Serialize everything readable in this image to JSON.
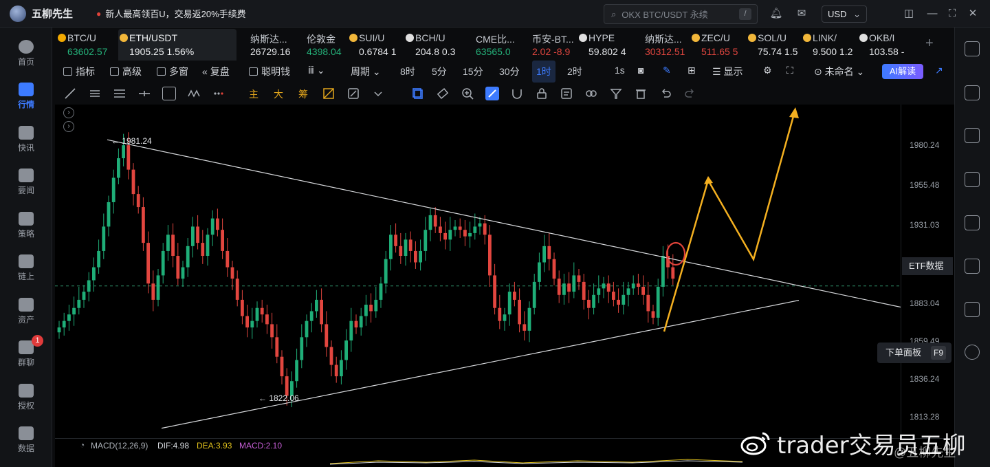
{
  "app": {
    "title": "五柳先生",
    "promo": "新人最高领百U，交易返20%手续费",
    "search_placeholder": "OKX BTC/USDT 永续",
    "search_shortcut": "/",
    "currency": "USD"
  },
  "left_nav": [
    {
      "label": "首页",
      "icon": "home-icon"
    },
    {
      "label": "行情",
      "icon": "market-chart-icon",
      "active": true
    },
    {
      "label": "快讯",
      "icon": "flash-news-icon"
    },
    {
      "label": "要闻",
      "icon": "news-icon"
    },
    {
      "label": "策略",
      "icon": "robot-strategy-icon"
    },
    {
      "label": "链上",
      "icon": "onchain-icon"
    },
    {
      "label": "资产",
      "icon": "wallet-icon"
    },
    {
      "label": "群聊",
      "icon": "chat-icon",
      "badge": "1"
    },
    {
      "label": "授权",
      "icon": "key-icon"
    },
    {
      "label": "数据",
      "icon": "data-icon"
    }
  ],
  "tickers": [
    {
      "name": "BTC/U",
      "value": "63602.57",
      "trend": "up",
      "coin_color": "#f2a900"
    },
    {
      "name": "ETH/USDT",
      "value": "1905.25  1.56%",
      "trend": "up",
      "active": true,
      "coin_color": "#f2b73a"
    },
    {
      "name": "纳斯达...",
      "value": "26729.16",
      "trend": "neutral"
    },
    {
      "name": "伦敦金",
      "value": "4398.04",
      "trend": "up"
    },
    {
      "name": "SUI/U",
      "value": "0.6784  1",
      "trend": "neutral",
      "coin_color": "#f2b73a"
    },
    {
      "name": "BCH/U",
      "value": "204.8  0.3",
      "trend": "neutral",
      "coin_color": "#e0e0e0"
    },
    {
      "name": "CME比...",
      "value": "63565.0",
      "trend": "up"
    },
    {
      "name": "币安-BT...",
      "value": "2.02  -8.9",
      "trend": "down"
    },
    {
      "name": "HYPE",
      "value": "59.802  4",
      "trend": "neutral",
      "coin_color": "#e0e0e0"
    },
    {
      "name": "纳斯达...",
      "value": "30312.51",
      "trend": "down"
    },
    {
      "name": "ZEC/U",
      "value": "511.65  5",
      "trend": "down",
      "coin_color": "#f2b73a"
    },
    {
      "name": "SOL/U",
      "value": "75.74  1.5",
      "trend": "neutral",
      "coin_color": "#f2b73a"
    },
    {
      "name": "LINK/",
      "value": "9.500  1.2",
      "trend": "neutral",
      "coin_color": "#f2b73a"
    },
    {
      "name": "OKB/I",
      "value": "103.58  -",
      "trend": "neutral",
      "coin_color": "#e0e0e0"
    }
  ],
  "toolbar": {
    "indicators": "指标",
    "advanced": "高级",
    "multi_window": "多窗",
    "replay": "复盘",
    "smart_money": "聪明钱",
    "period": "周期",
    "timeframes": [
      "8时",
      "5分",
      "15分",
      "30分",
      "1时",
      "2时",
      "1s"
    ],
    "active_timeframe": "1时",
    "display": "显示",
    "layout_name": "未命名",
    "ai_button": "AI解读"
  },
  "drawing_tools_cn": [
    "主",
    "大",
    "筹"
  ],
  "price_axis": {
    "ticks": [
      "1980.24",
      "1955.48",
      "1931.03",
      "1883.04",
      "1859.49",
      "1836.24",
      "1813.28"
    ],
    "etf_tag": "ETF数据",
    "order_panel": "下单面板",
    "order_panel_key": "F9"
  },
  "chart_data": {
    "type": "candlestick",
    "symbol": "ETH/USDT",
    "interval": "1时",
    "ylim": [
      1800,
      2005
    ],
    "high_label": "1981.24",
    "low_label": "1822.06",
    "current_price": 1893.5,
    "candles_close": [
      1868,
      1872,
      1876,
      1880,
      1885,
      1890,
      1897,
      1905,
      1915,
      1930,
      1945,
      1960,
      1972,
      1980,
      1965,
      1950,
      1942,
      1920,
      1895,
      1885,
      1900,
      1915,
      1925,
      1912,
      1898,
      1905,
      1918,
      1930,
      1920,
      1912,
      1925,
      1935,
      1928,
      1915,
      1905,
      1898,
      1885,
      1875,
      1868,
      1872,
      1880,
      1876,
      1870,
      1862,
      1850,
      1838,
      1826,
      1835,
      1848,
      1862,
      1872,
      1878,
      1885,
      1870,
      1856,
      1845,
      1838,
      1848,
      1860,
      1872,
      1868,
      1875,
      1882,
      1878,
      1885,
      1895,
      1910,
      1925,
      1918,
      1912,
      1922,
      1915,
      1908,
      1915,
      1928,
      1937,
      1930,
      1926,
      1922,
      1928,
      1930,
      1928,
      1924,
      1926,
      1930,
      1932,
      1925,
      1900,
      1880,
      1872,
      1876,
      1890,
      1885,
      1870,
      1866,
      1880,
      1896,
      1908,
      1918,
      1910,
      1898,
      1888,
      1895,
      1890,
      1900,
      1896,
      1885,
      1880,
      1888,
      1892,
      1895,
      1890,
      1885,
      1882,
      1888,
      1892,
      1895,
      1893,
      1888,
      1878,
      1874,
      1893,
      1912,
      1905,
      1898
    ],
    "resistance_line": {
      "from": [
        0,
        1981.24
      ],
      "to": [
        160,
        1883.04
      ]
    },
    "support_line": {
      "from": [
        20,
        1812
      ],
      "to": [
        140,
        1883
      ]
    },
    "projection": [
      [
        1870,
        1875
      ],
      [
        1956,
        1880
      ],
      [
        1903,
        1888
      ],
      [
        1999,
        1895
      ]
    ]
  },
  "macd": {
    "label": "MACD(12,26,9)",
    "dif": "DIF:4.98",
    "dea": "DEA:3.93",
    "macd": "MACD:2.10"
  },
  "watermark": {
    "text": "trader交易员五柳",
    "sub": "@五柳先生"
  }
}
